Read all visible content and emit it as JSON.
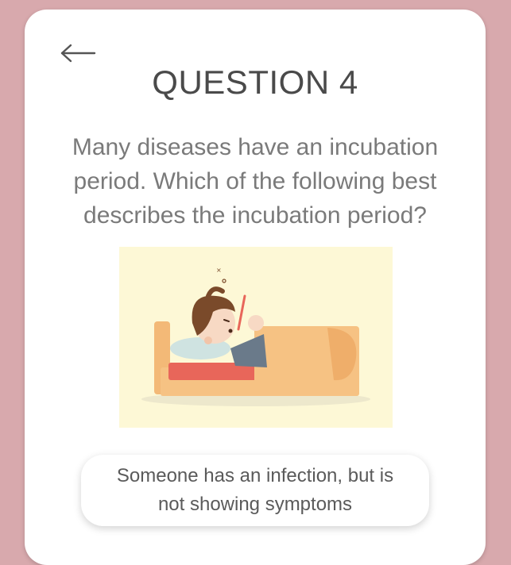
{
  "header": {
    "back_icon": "arrow-left-icon",
    "title": "QUESTION 4"
  },
  "question": {
    "text": "Many diseases have an incubation period. Which of the following best describes the incubation period?"
  },
  "illustration": {
    "icon": "sick-person-in-bed-illustration",
    "background_color": "#fdf8d6"
  },
  "answers": [
    {
      "label": "Someone has an infection, but is not showing symptoms"
    }
  ],
  "colors": {
    "page_background": "#d8a9ad",
    "card_background": "#ffffff",
    "title_text": "#4a4a4a",
    "body_text": "#7a7a7a"
  }
}
